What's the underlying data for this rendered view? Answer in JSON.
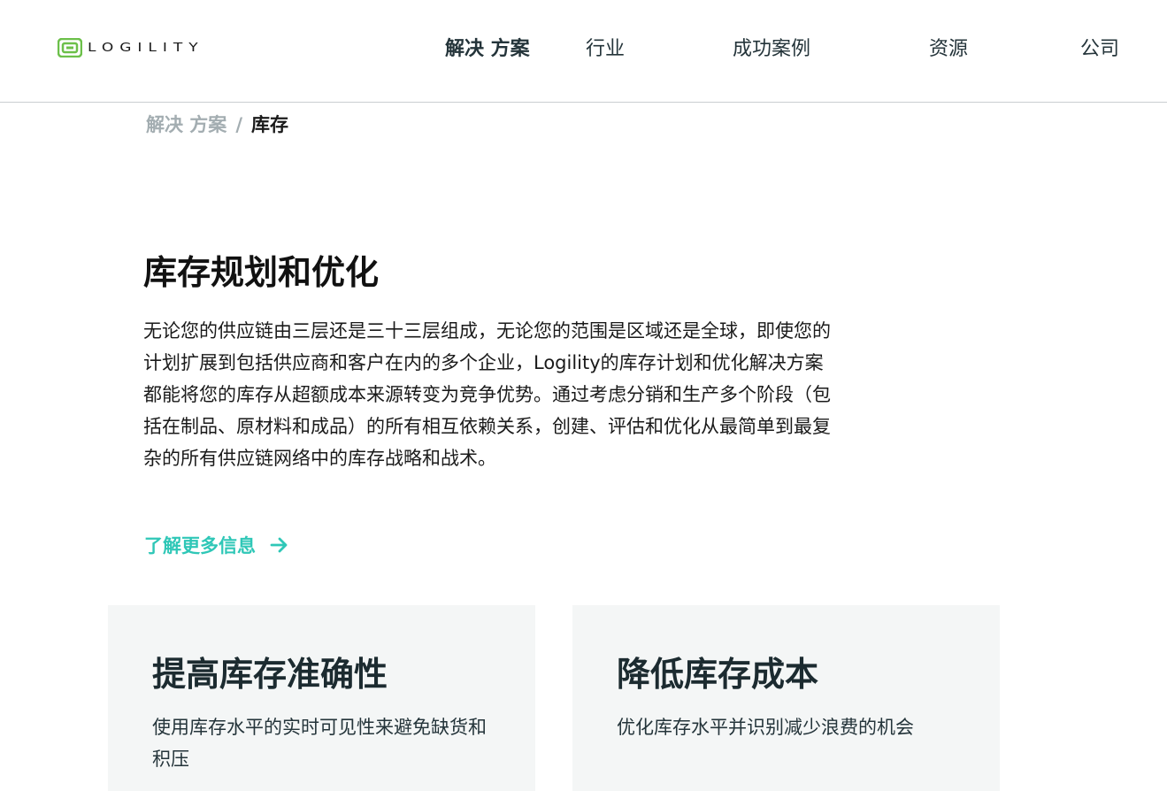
{
  "brand": {
    "logo_text": "LOGILITY",
    "logo_color": "#6cc04a"
  },
  "nav": {
    "items": [
      {
        "label": "解决 方案",
        "active": true
      },
      {
        "label": "行业"
      },
      {
        "label": "成功案例"
      },
      {
        "label": "资源"
      },
      {
        "label": "公司"
      }
    ]
  },
  "breadcrumb": {
    "parent": "解决 方案",
    "separator": "/",
    "current": "库存"
  },
  "hero": {
    "title": "库存规划和优化",
    "body": "无论您的供应链由三层还是三十三层组成，无论您的范围是区域还是全球，即使您的计划扩展到包括供应商和客户在内的多个企业，Logility的库存计划和优化解决方案都能将您的库存从超额成本来源转变为竞争优势。通过考虑分销和生产多个阶段（包括在制品、原材料和成品）的所有相互依赖关系，创建、评估和优化从最简单到最复杂的所有供应链网络中的库存战略和战术。",
    "cta_label": "了解更多信息",
    "cta_icon": "arrow-right-icon",
    "accent_color": "#2fc7b7"
  },
  "cards": [
    {
      "title": "提高库存准确性",
      "text": "使用库存水平的实时可见性来避免缺货和积压"
    },
    {
      "title": "降低库存成本",
      "text": "优化库存水平并识别减少浪费的机会"
    }
  ]
}
